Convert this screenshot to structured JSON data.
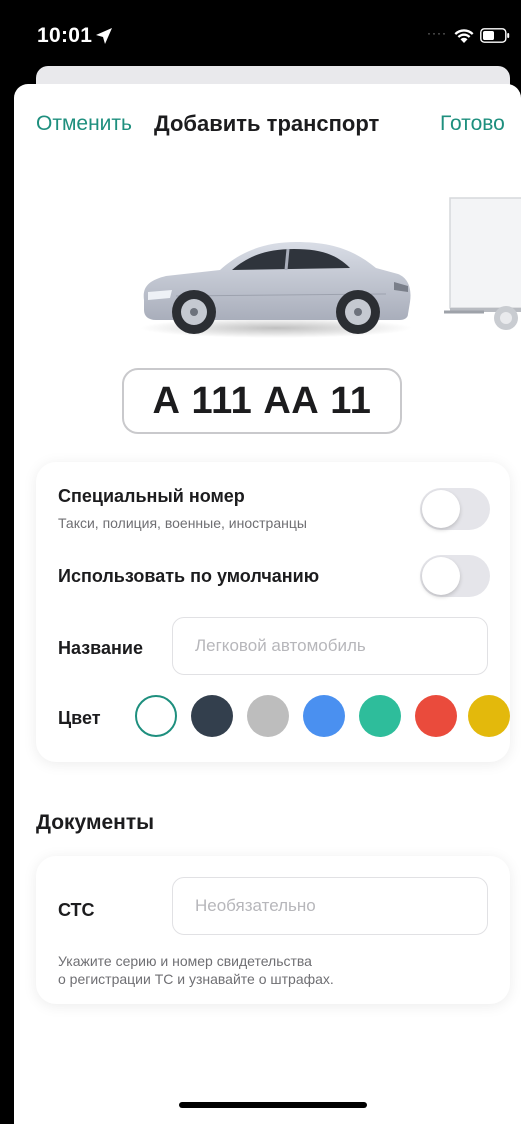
{
  "status_bar": {
    "time": "10:01",
    "icons": [
      "location-arrow-icon",
      "cellular-dots-icon",
      "wifi-icon",
      "battery-icon"
    ]
  },
  "nav": {
    "cancel_label": "Отменить",
    "title": "Добавить транспорт",
    "done_label": "Готово"
  },
  "vehicles": {
    "items": [
      "car",
      "truck"
    ],
    "selected": "car"
  },
  "plate": {
    "number": "А 111 АА 11"
  },
  "settings": {
    "special_number": {
      "title": "Специальный номер",
      "subtitle": "Такси, полиция, военные, иностранцы",
      "enabled": false
    },
    "default_use": {
      "title": "Использовать по умолчанию",
      "enabled": false
    },
    "name": {
      "label": "Название",
      "value": "",
      "placeholder": "Легковой автомобиль"
    },
    "color": {
      "label": "Цвет",
      "selected_index": 0,
      "swatches": [
        "#ffffff",
        "#333f4d",
        "#bdbdbd",
        "#4a90f0",
        "#2ebd9b",
        "#ea4b3c",
        "#e3b90c"
      ]
    }
  },
  "documents": {
    "title": "Документы",
    "sts": {
      "label": "СТС",
      "value": "",
      "placeholder": "Необязательно",
      "help_line1": "Укажите серию и номер свидетельства",
      "help_line2": "о регистрации ТС и узнавайте о штрафах."
    }
  },
  "colors": {
    "accent": "#1e8f7e",
    "background": "#ffffff",
    "toggle_off": "#e5e5ea"
  }
}
